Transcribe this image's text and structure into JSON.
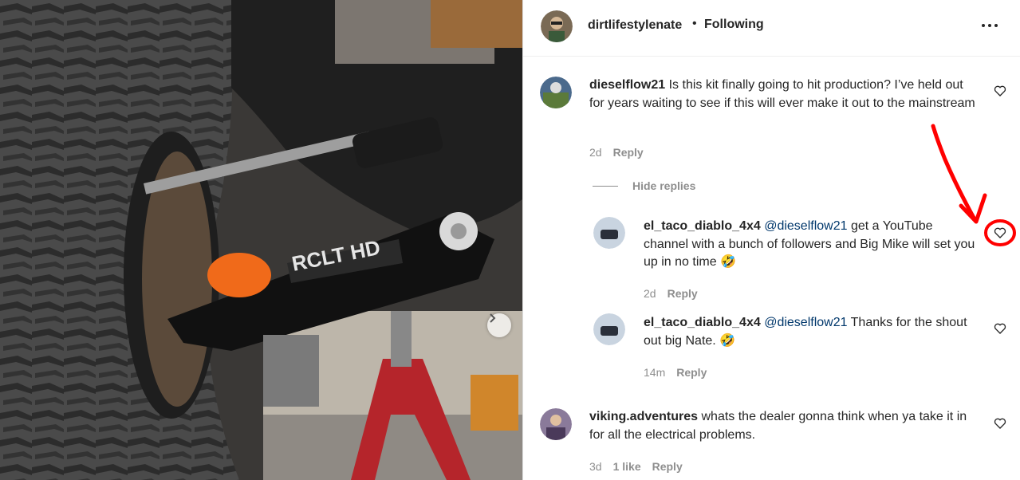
{
  "post": {
    "author": "dirtlifestylenate",
    "separator": "•",
    "follow_status": "Following",
    "photo_text": "RCLT HD"
  },
  "comments": [
    {
      "user": "dieselflow21",
      "text": " Is this kit finally going to hit production? I’ve held out for years waiting to see if this will ever make it out to the mainstream",
      "age": "2d",
      "reply": "Reply"
    }
  ],
  "hide_replies": "Hide replies",
  "replies": [
    {
      "user": "el_taco_diablo_4x4",
      "mention": "@dieselflow21",
      "text": " get a YouTube channel with a bunch of followers and Big Mike will set you up in no time 🤣",
      "age": "2d",
      "reply": "Reply"
    },
    {
      "user": "el_taco_diablo_4x4",
      "mention": "@dieselflow21",
      "text": " Thanks for the shout out big Nate. 🤣",
      "age": "14m",
      "reply": "Reply"
    }
  ],
  "comment2": {
    "user": "viking.adventures",
    "text": " whats the dealer gonna think when ya take it in for all the electrical problems.",
    "age": "3d",
    "likes": "1 like",
    "reply": "Reply"
  },
  "colors": {
    "annotation": "#ff0000",
    "mention": "#00376b",
    "meta": "#8e8e8e"
  },
  "icons": {
    "more": "more-options-icon",
    "heart": "heart-outline-icon",
    "next": "chevron-right-icon"
  }
}
